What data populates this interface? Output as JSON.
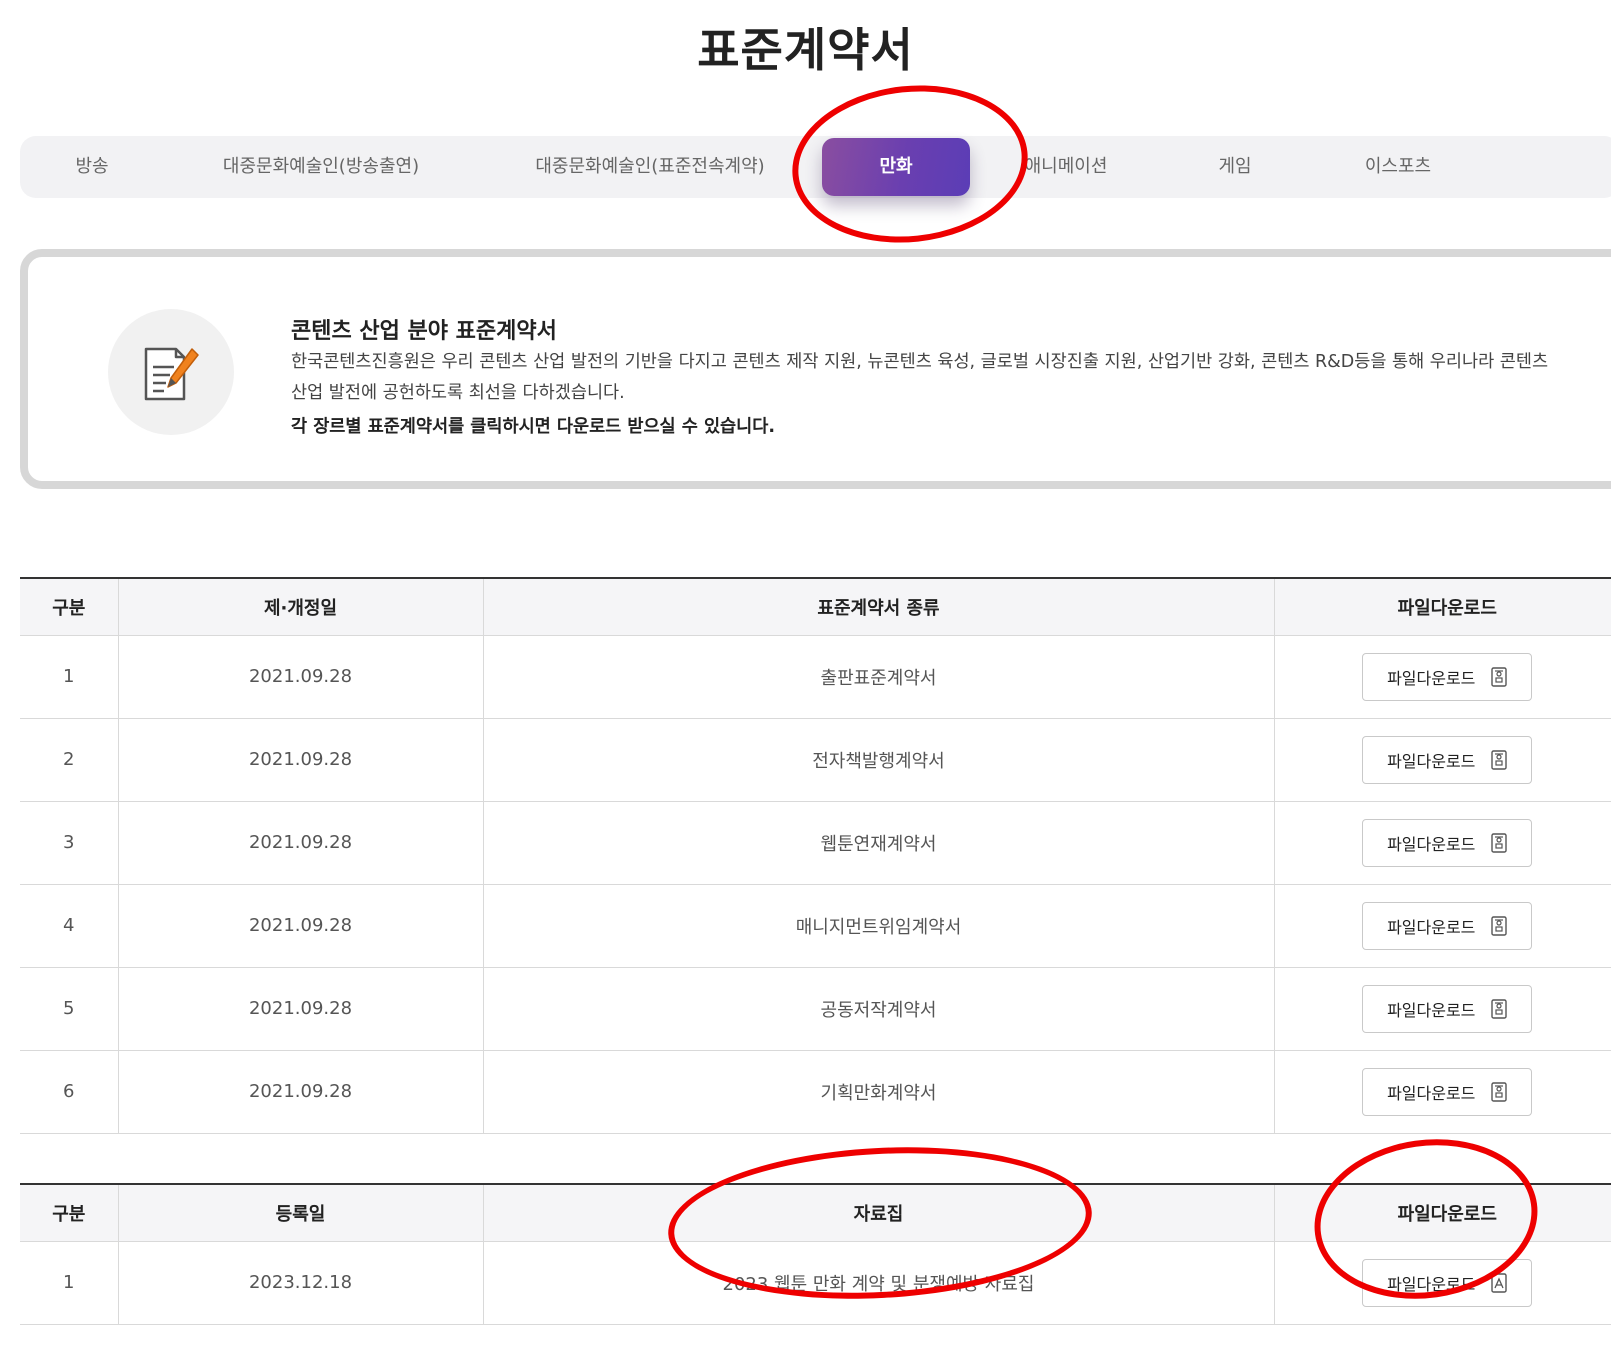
{
  "page": {
    "title": "표준계약서"
  },
  "tabs": [
    {
      "label": "방송",
      "active": false
    },
    {
      "label": "대중문화예술인(방송출연)",
      "active": false
    },
    {
      "label": "대중문화예술인(표준전속계약)",
      "active": false
    },
    {
      "label": "만화",
      "active": true
    },
    {
      "label": "애니메이션",
      "active": false
    },
    {
      "label": "게임",
      "active": false
    },
    {
      "label": "이스포츠",
      "active": false
    }
  ],
  "info": {
    "icon": "document-edit-icon",
    "title": "콘텐츠 산업 분야 표준계약서",
    "description": "한국콘텐츠진흥원은 우리 콘텐츠 산업 발전의 기반을 다지고 콘텐츠 제작 지원, 뉴콘텐츠 육성, 글로벌 시장진출 지원, 산업기반 강화, 콘텐츠 R&D등을 통해 우리나라 콘텐츠 산업 발전에 공헌하도록 최선을 다하겠습니다.",
    "note": "각 장르별 표준계약서를 클릭하시면 다운로드 받으실 수 있습니다."
  },
  "contracts_table": {
    "headers": [
      "구분",
      "제·개정일",
      "표준계약서 종류",
      "파일다운로드"
    ],
    "rows": [
      {
        "no": "1",
        "date": "2021.09.28",
        "name": "출판표준계약서",
        "download": "파일다운로드",
        "file_icon": "hwp-file-icon"
      },
      {
        "no": "2",
        "date": "2021.09.28",
        "name": "전자책발행계약서",
        "download": "파일다운로드",
        "file_icon": "hwp-file-icon"
      },
      {
        "no": "3",
        "date": "2021.09.28",
        "name": "웹툰연재계약서",
        "download": "파일다운로드",
        "file_icon": "hwp-file-icon"
      },
      {
        "no": "4",
        "date": "2021.09.28",
        "name": "매니지먼트위임계약서",
        "download": "파일다운로드",
        "file_icon": "hwp-file-icon"
      },
      {
        "no": "5",
        "date": "2021.09.28",
        "name": "공동저작계약서",
        "download": "파일다운로드",
        "file_icon": "hwp-file-icon"
      },
      {
        "no": "6",
        "date": "2021.09.28",
        "name": "기획만화계약서",
        "download": "파일다운로드",
        "file_icon": "hwp-file-icon"
      }
    ]
  },
  "materials_table": {
    "headers": [
      "구분",
      "등록일",
      "자료집",
      "파일다운로드"
    ],
    "rows": [
      {
        "no": "1",
        "date": "2023.12.18",
        "name": "2023 웹툰 만화 계약 및 분쟁예방 자료집",
        "download": "파일다운로드",
        "file_icon": "pdf-file-icon"
      }
    ]
  },
  "colors": {
    "active_tab_start": "#8a4ea0",
    "active_tab_end": "#5b3db6",
    "annotation": "#ee0000",
    "pencil": "#f0821e"
  }
}
